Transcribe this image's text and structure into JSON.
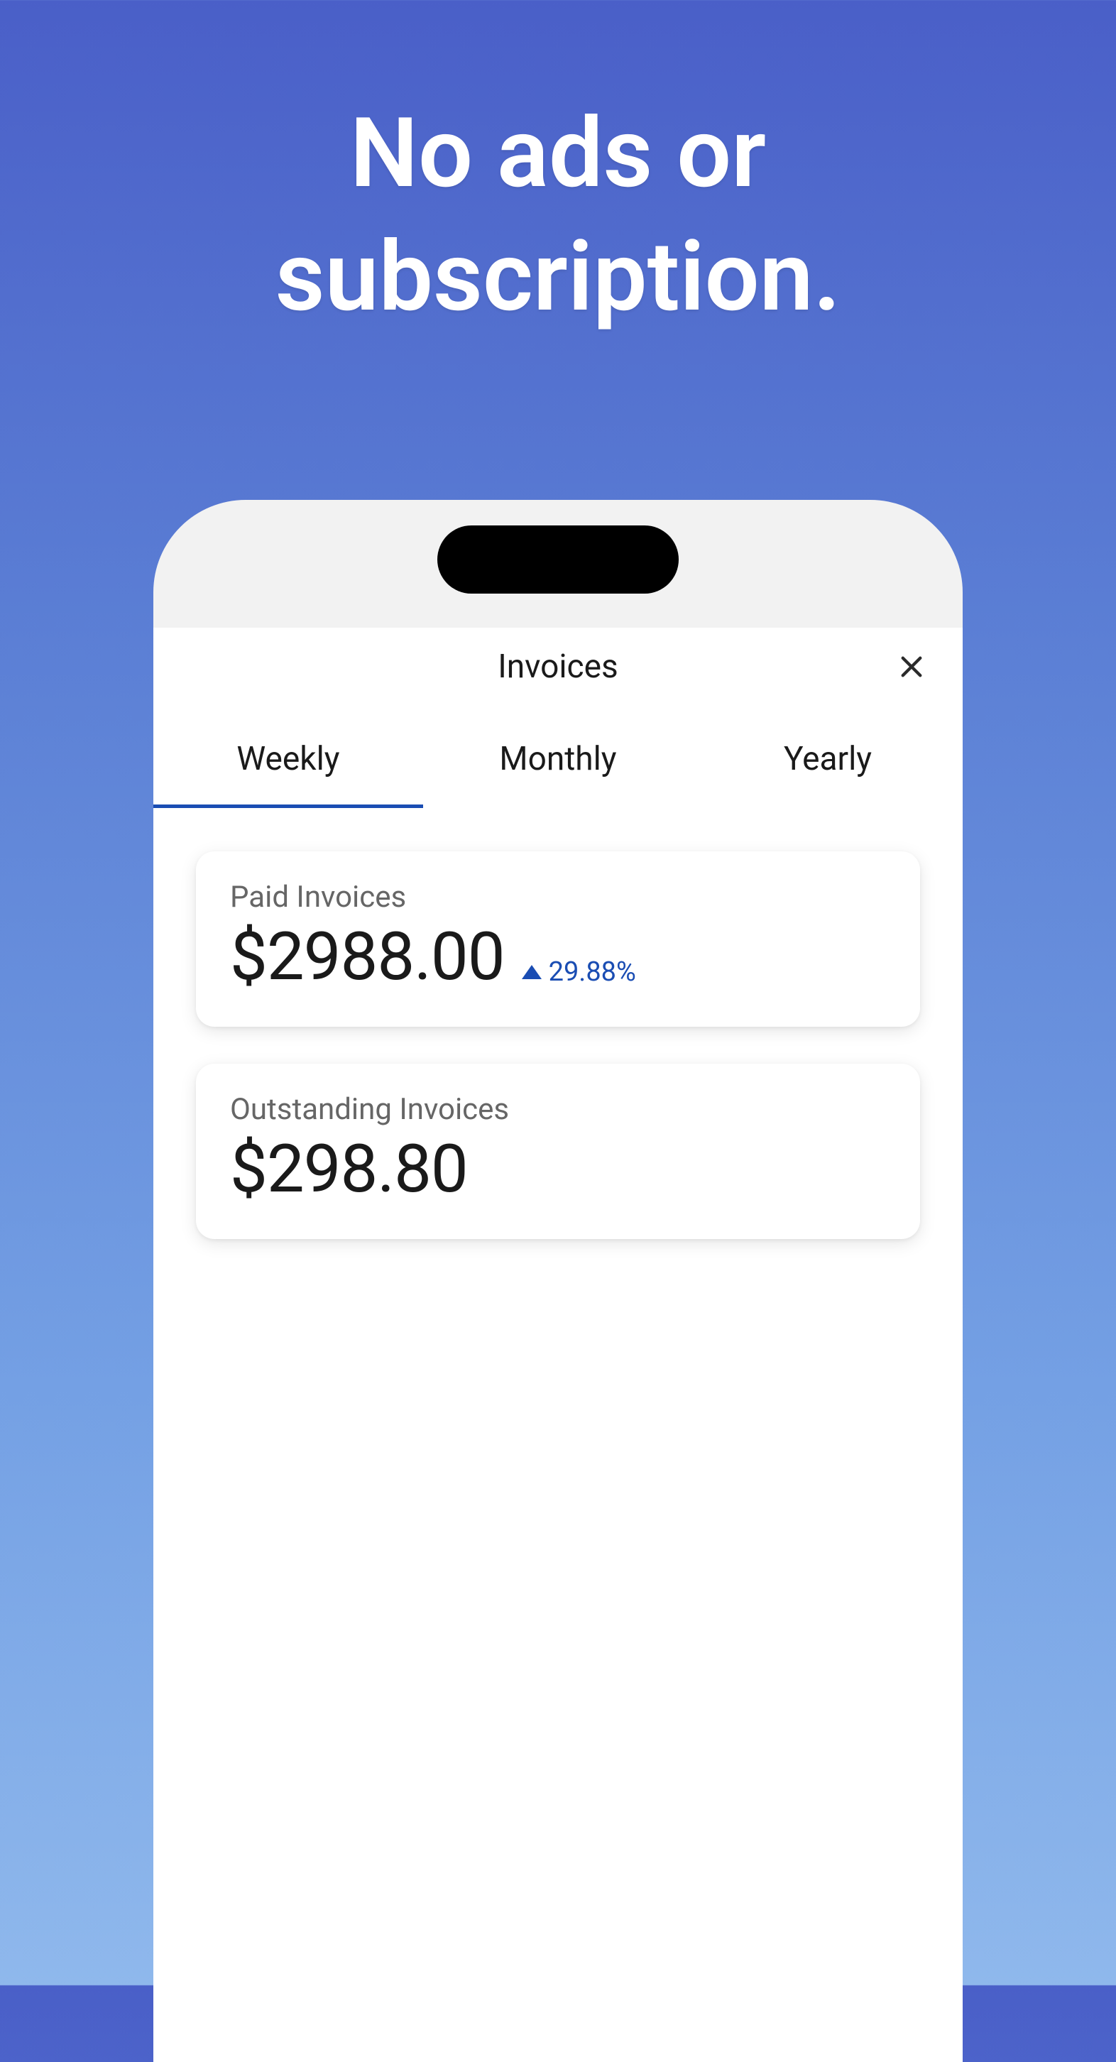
{
  "hero": {
    "line1": "No ads or",
    "line2": "subscription."
  },
  "header": {
    "title": "Invoices"
  },
  "tabs": [
    {
      "label": "Weekly",
      "active": true
    },
    {
      "label": "Monthly",
      "active": false
    },
    {
      "label": "Yearly",
      "active": false
    }
  ],
  "cards": {
    "paid": {
      "label": "Paid Invoices",
      "value": "$2988.00",
      "change": "29.88%"
    },
    "outstanding": {
      "label": "Outstanding Invoices",
      "value": "$298.80"
    }
  }
}
